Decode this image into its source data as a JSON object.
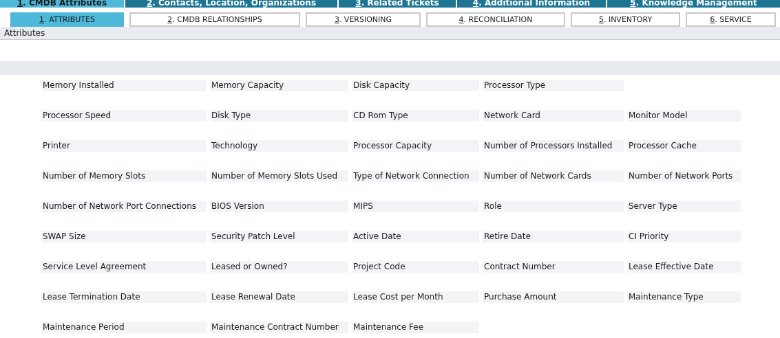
{
  "main_tabs": [
    {
      "key": "1",
      "label": ". CMDB Attributes",
      "selected": true
    },
    {
      "key": "2",
      "label": ". Contacts, Location, Organizations",
      "selected": false
    },
    {
      "key": "3",
      "label": ". Related Tickets",
      "selected": false
    },
    {
      "key": "4",
      "label": ". Additional Information",
      "selected": false
    },
    {
      "key": "5",
      "label": ". Knowledge Management",
      "selected": false
    }
  ],
  "sub_tabs": [
    {
      "key": "1",
      "label": ". ATTRIBUTES",
      "selected": true
    },
    {
      "key": "2",
      "label": ". CMDB RELATIONSHIPS",
      "selected": false
    },
    {
      "key": "3",
      "label": ". VERSIONING",
      "selected": false
    },
    {
      "key": "4",
      "label": ". RECONCILIATION",
      "selected": false
    },
    {
      "key": "5",
      "label": ". INVENTORY",
      "selected": false
    },
    {
      "key": "6",
      "label": ". SERVICE",
      "selected": false
    }
  ],
  "section_title": "Attributes",
  "fields": [
    [
      "Memory Installed",
      "Memory Capacity",
      "Disk Capacity",
      "Processor Type"
    ],
    [
      "Processor Speed",
      "Disk Type",
      "CD Rom Type",
      "Network Card",
      "Monitor Model"
    ],
    [
      "Printer",
      "Technology",
      "Processor Capacity",
      "Number of Processors Installed",
      "Processor Cache"
    ],
    [
      "Number of Memory Slots",
      "Number of Memory Slots Used",
      "Type of Network Connection",
      "Number of Network Cards",
      "Number of Network Ports"
    ],
    [
      "Number of Network Port Connections",
      "BIOS Version",
      "MIPS",
      "Role",
      "Server Type"
    ],
    [
      "SWAP Size",
      "Security Patch Level",
      "Active Date",
      "Retire Date",
      "CI Priority"
    ],
    [
      "Service Level Agreement",
      "Leased or Owned?",
      "Project Code",
      "Contract Number",
      "Lease Effective Date"
    ],
    [
      "Lease Termination Date",
      "Lease Renewal Date",
      "Lease Cost per Month",
      "Purchase Amount",
      "Maintenance Type"
    ],
    [
      "Maintenance Period",
      "Maintenance Contract Number",
      "Maintenance Fee"
    ]
  ]
}
